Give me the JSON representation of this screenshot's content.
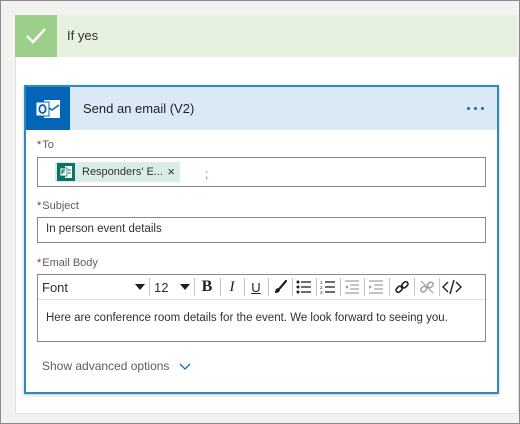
{
  "branch": {
    "title": "If yes"
  },
  "action": {
    "title": "Send an email (V2)",
    "menu_icon": "more-icon",
    "brand_icon": "outlook-icon"
  },
  "fields": {
    "to": {
      "label": "To",
      "required_mark": "*",
      "token_label": "Responders' E...",
      "token_icon": "forms-icon",
      "token_close": "×",
      "separator": ";"
    },
    "subject": {
      "label": "Subject",
      "required_mark": "*",
      "value": "In person event details"
    },
    "body": {
      "label": "Email Body",
      "required_mark": "*",
      "font": "Font",
      "font_size": "12",
      "bold": "B",
      "italic": "I",
      "underline": "U",
      "value": "Here are conference room details for the event. We look forward to seeing you."
    }
  },
  "advanced_options": {
    "label": "Show advanced options"
  },
  "colors": {
    "accent": "#2e8bc0",
    "outlook_blue": "#0364b8",
    "success_green": "#9ccf8a",
    "required_red": "#a4262c"
  }
}
